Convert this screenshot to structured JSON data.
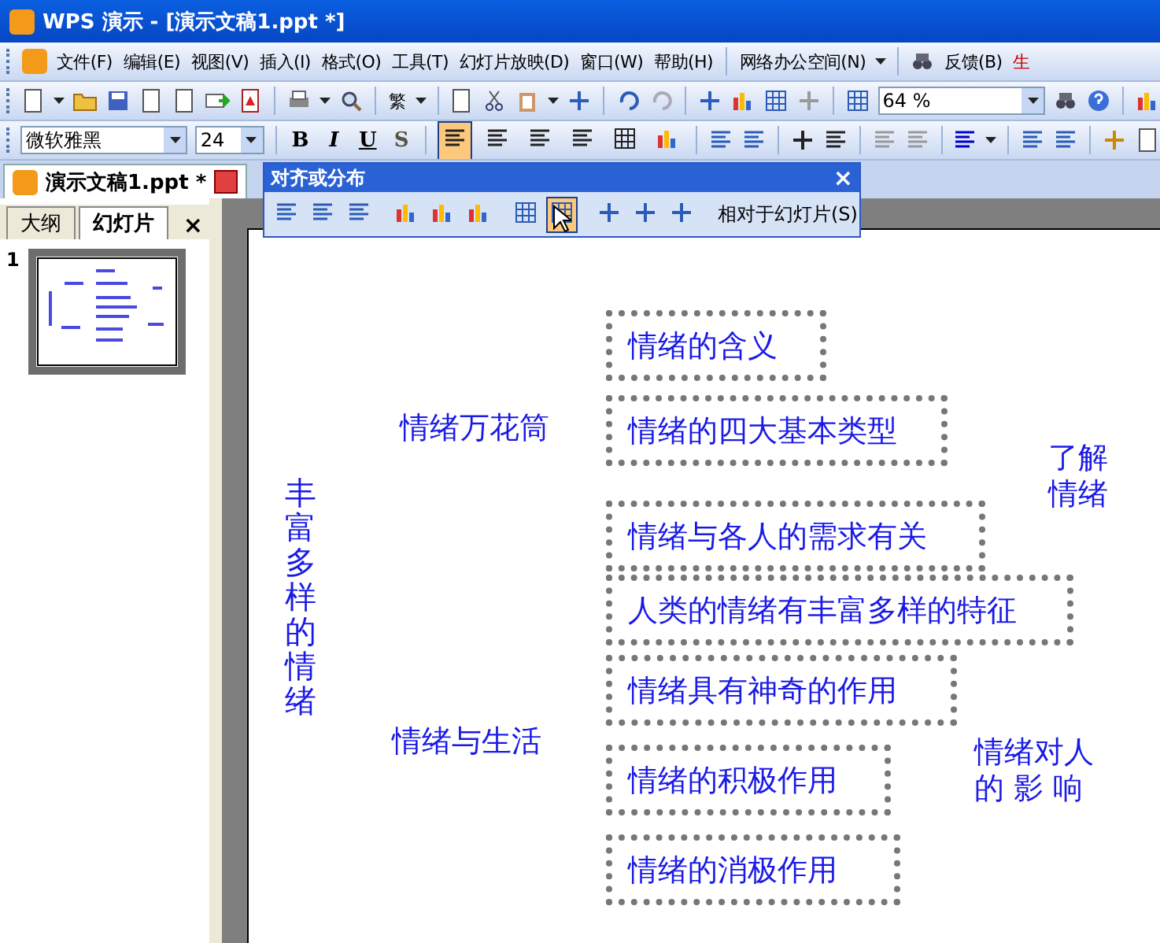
{
  "window": {
    "title": "WPS 演示 - [演示文稿1.ppt *]"
  },
  "menu": {
    "items": [
      "文件(F)",
      "编辑(E)",
      "视图(V)",
      "插入(I)",
      "格式(O)",
      "工具(T)",
      "幻灯片放映(D)",
      "窗口(W)",
      "帮助(H)"
    ],
    "workspace": "网络办公空间(N)",
    "feedback": "反馈(B)",
    "cut_item": "生"
  },
  "toolbar": {
    "traditional": "繁",
    "zoom": "64 %"
  },
  "format_bar": {
    "font": "微软雅黑",
    "size": "24",
    "bold": "B",
    "italic": "I",
    "underline": "U",
    "shadow": "S",
    "align": [
      {
        "selected": true
      },
      {
        "selected": false
      },
      {
        "selected": false
      },
      {
        "selected": false
      },
      {
        "selected": false
      },
      {
        "selected": false
      }
    ]
  },
  "document_tab": {
    "label": "演示文稿1.ppt *"
  },
  "align_panel": {
    "title": "对齐或分布",
    "close": "×",
    "tools": [
      {
        "selected": false
      },
      {
        "selected": false
      },
      {
        "selected": false
      },
      {
        "selected": false
      },
      {
        "selected": false
      },
      {
        "selected": false
      },
      {
        "selected": false
      },
      {
        "selected": true
      },
      {
        "selected": false
      },
      {
        "selected": false
      },
      {
        "selected": false
      }
    ],
    "relative": "相对于幻灯片(S)"
  },
  "side_panel": {
    "tabs": [
      {
        "label": "大纲",
        "selected": false
      },
      {
        "label": "幻灯片",
        "selected": true
      }
    ],
    "close": "×",
    "thumbnails": [
      {
        "number": "1",
        "selected": true
      }
    ]
  },
  "slide": {
    "objects": [
      {
        "kind": "box",
        "text": "情绪的含义",
        "selected": true
      },
      {
        "kind": "box",
        "text": "情绪的四大基本类型",
        "selected": true
      },
      {
        "kind": "box",
        "text": "情绪与各人的需求有关",
        "selected": true
      },
      {
        "kind": "box",
        "text": "人类的情绪有丰富多样的特征",
        "selected": true
      },
      {
        "kind": "box",
        "text": "情绪具有神奇的作用",
        "selected": true
      },
      {
        "kind": "box",
        "text": "情绪的积极作用",
        "selected": true
      },
      {
        "kind": "box",
        "text": "情绪的消极作用",
        "selected": true
      },
      {
        "kind": "label",
        "text": "情绪万花筒"
      },
      {
        "kind": "label",
        "text": "了解情绪"
      },
      {
        "kind": "vertical",
        "text": "丰富多样的情绪"
      },
      {
        "kind": "label",
        "text": "情绪与生活"
      },
      {
        "kind": "label",
        "text": "情绪对人的 影 响"
      }
    ]
  }
}
